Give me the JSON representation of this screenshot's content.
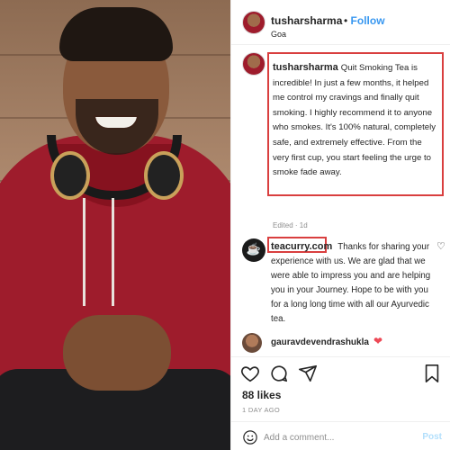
{
  "post": {
    "username": "tusharsharma",
    "follow_label": "Follow",
    "separator": "•",
    "location": "Goa",
    "more_icon": "more-dots-icon"
  },
  "caption": {
    "username": "tusharsharma",
    "text": "Quit Smoking Tea is incredible! In just a few months, it helped me control my cravings and finally quit smoking. I highly recommend it to anyone who smokes. It's 100% natural, completely safe, and extremely effective. From the very first cup, you start feeling the urge to smoke fade away.",
    "edited": "Edited · 1d"
  },
  "reply": {
    "username": "teacurry.com",
    "text": "Thanks for sharing your experience with us. We are glad that we were able to impress you and are helping you in your Journey. Hope to be with you for a long long time with all our Ayurvedic tea."
  },
  "liker": {
    "username": "gauravdevendrashukla"
  },
  "engagement": {
    "likes": "88 likes",
    "date": "1 DAY AGO"
  },
  "comment": {
    "placeholder": "Add a comment...",
    "post_label": "Post"
  },
  "colors": {
    "follow": "#3897f0",
    "highlight_box": "#d93f3f",
    "heart": "#ed4956"
  }
}
